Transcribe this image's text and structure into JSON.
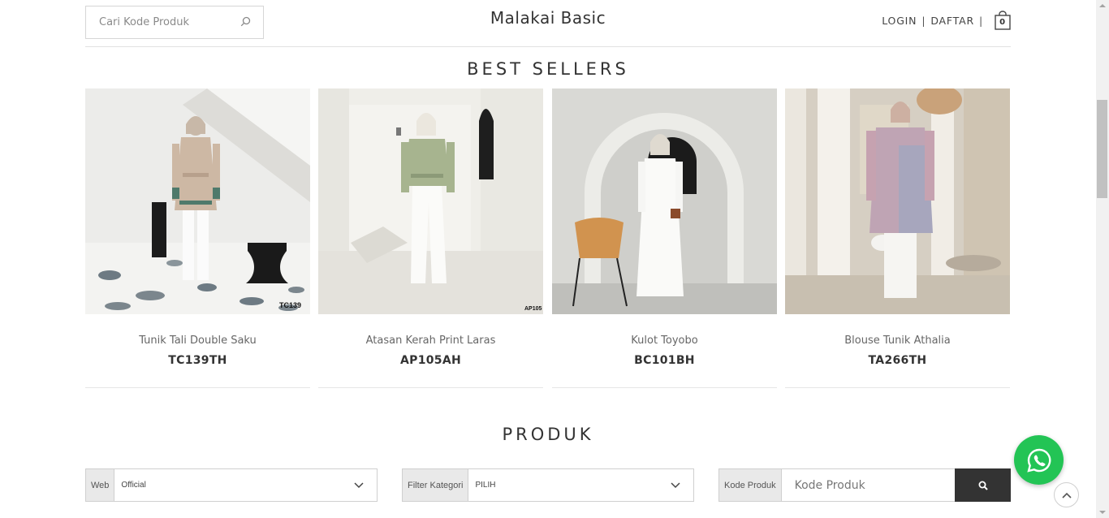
{
  "header": {
    "search_placeholder": "Cari Kode Produk",
    "brand": "Malakai Basic",
    "login": "LOGIN",
    "separator": "|",
    "register": "DAFTAR",
    "cart_count": "0"
  },
  "best_sellers": {
    "title": "BEST SELLERS",
    "items": [
      {
        "name": "Tunik Tali Double Saku",
        "code": "TC139TH",
        "tag": "TC139"
      },
      {
        "name": "Atasan Kerah Print Laras",
        "code": "AP105AH",
        "tag": "AP105"
      },
      {
        "name": "Kulot Toyobo",
        "code": "BC101BH",
        "tag": ""
      },
      {
        "name": "Blouse Tunik Athalia",
        "code": "TA266TH",
        "tag": ""
      }
    ]
  },
  "produk": {
    "title": "PRODUK",
    "web_label": "Web",
    "web_value": "Official",
    "kategori_label": "Filter Kategori",
    "kategori_value": "PILIH",
    "kode_label": "Kode Produk",
    "kode_placeholder": "Kode Produk"
  },
  "icons": {
    "search": "search-icon",
    "cart": "shopping-bag-icon",
    "whatsapp": "whatsapp-icon",
    "back_to_top": "chevron-up-icon",
    "dropdown": "chevron-down-icon"
  },
  "colors": {
    "whatsapp": "#23c455",
    "search_button": "#333333",
    "label_bg": "#e9e9e9"
  }
}
